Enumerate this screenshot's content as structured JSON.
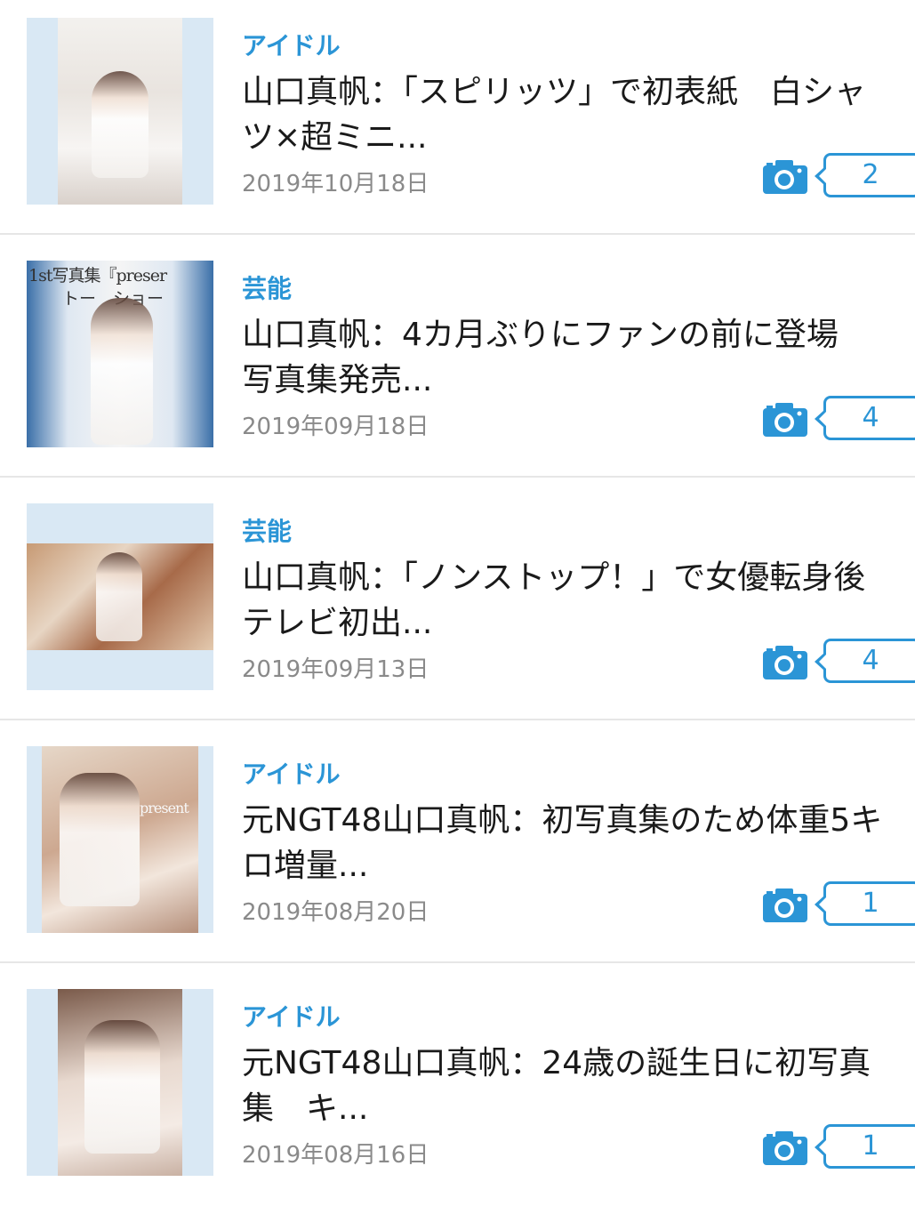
{
  "colors": {
    "accent": "#2b95d6",
    "date": "#8a8a8a",
    "divider": "#e6e6e6",
    "thumb_bg": "#d9e8f4"
  },
  "articles": [
    {
      "category": "アイドル",
      "title_line1": "山口真帆：「スピリッツ」で初表紙　白シャ",
      "title_line2": "ツ×超ミニ...",
      "date": "2019年10月18日",
      "photo_count": "2",
      "icon": "camera-icon"
    },
    {
      "category": "芸能",
      "title_line1": "山口真帆：4カ月ぶりにファンの前に登場",
      "title_line2": "写真集発売...",
      "date": "2019年09月18日",
      "photo_count": "4",
      "thumb_text1": "1st写真集『preser",
      "thumb_text2": "トー　ショー",
      "icon": "camera-icon"
    },
    {
      "category": "芸能",
      "title_line1": "山口真帆：「ノンストップ！」で女優転身後",
      "title_line2": "テレビ初出...",
      "date": "2019年09月13日",
      "photo_count": "4",
      "icon": "camera-icon"
    },
    {
      "category": "アイドル",
      "title_line1": "元NGT48山口真帆：初写真集のため体重5キ",
      "title_line2": "ロ増量...",
      "date": "2019年08月20日",
      "photo_count": "1",
      "thumb_text1": "present",
      "icon": "camera-icon"
    },
    {
      "category": "アイドル",
      "title_line1": "元NGT48山口真帆：24歳の誕生日に初写真",
      "title_line2": "集　キ...",
      "date": "2019年08月16日",
      "photo_count": "1",
      "icon": "camera-icon"
    }
  ]
}
